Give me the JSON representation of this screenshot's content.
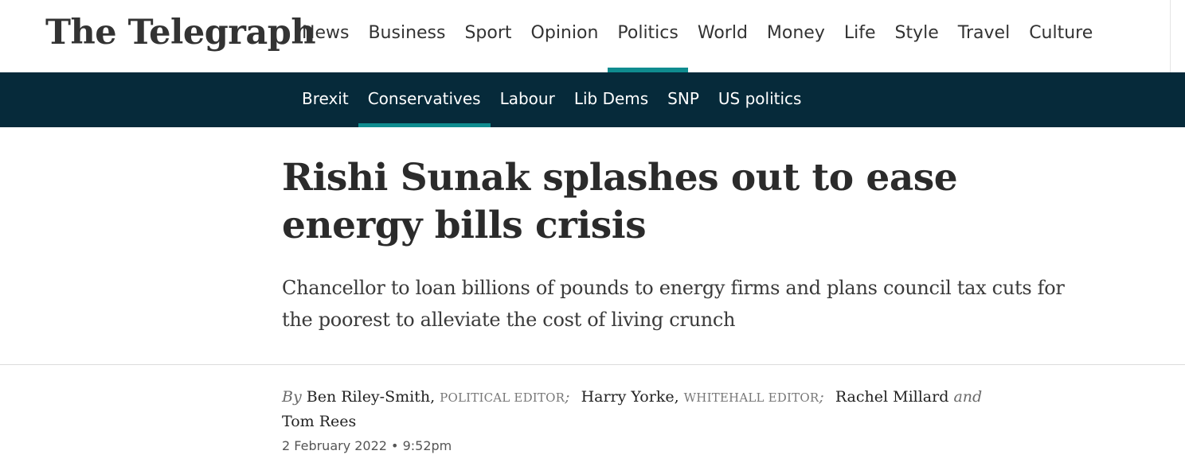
{
  "site": {
    "logo_text": "The Telegraph"
  },
  "primary_nav": [
    {
      "label": "News"
    },
    {
      "label": "Business"
    },
    {
      "label": "Sport"
    },
    {
      "label": "Opinion"
    },
    {
      "label": "Politics",
      "active": true
    },
    {
      "label": "World"
    },
    {
      "label": "Money"
    },
    {
      "label": "Life"
    },
    {
      "label": "Style"
    },
    {
      "label": "Travel"
    },
    {
      "label": "Culture"
    }
  ],
  "secondary_nav": [
    {
      "label": "Brexit"
    },
    {
      "label": "Conservatives",
      "active": true
    },
    {
      "label": "Labour"
    },
    {
      "label": "Lib Dems"
    },
    {
      "label": "SNP"
    },
    {
      "label": "US politics"
    }
  ],
  "article": {
    "headline": "Rishi Sunak splashes out to ease energy bills crisis",
    "standfirst": "Chancellor to loan billions of pounds to energy firms and plans council tax cuts for the poorest to alleviate the cost of living crunch",
    "byline": {
      "by": "By",
      "author1": "Ben Riley-Smith,",
      "role1": "POLITICAL EDITOR",
      "author2": "Harry Yorke,",
      "role2": "WHITEHALL EDITOR",
      "separator": ";",
      "author3": "Rachel Millard",
      "and": "and",
      "author4": "Tom Rees"
    },
    "dateline": "2 February 2022 • 9:52pm"
  },
  "colors": {
    "accent": "#0f8c8f",
    "subnav_bg": "#062a3a"
  }
}
